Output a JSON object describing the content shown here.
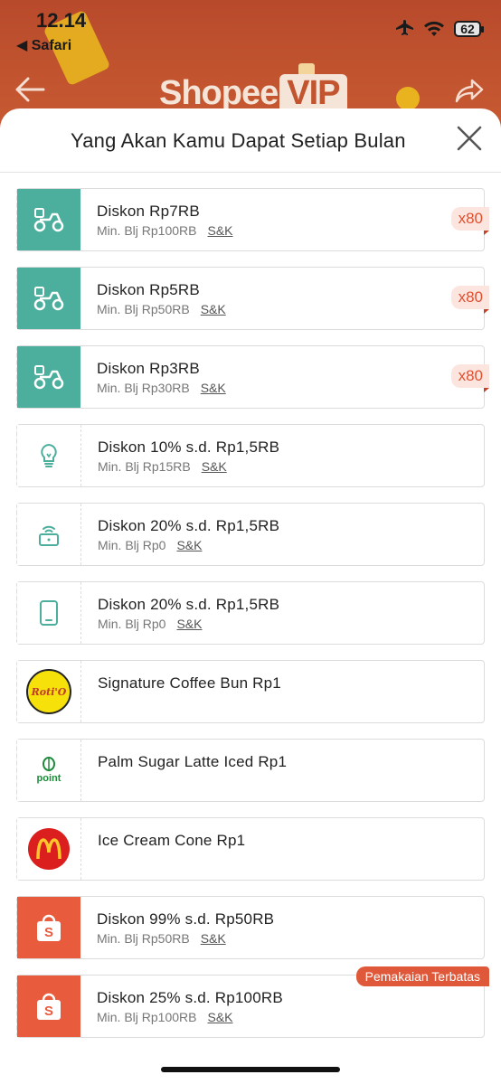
{
  "status": {
    "time": "12.14",
    "back_app": "◀ Safari",
    "battery": "62"
  },
  "brand": {
    "text": "Shopee",
    "vip": "VIP"
  },
  "sheet": {
    "title": "Yang Akan Kamu Dapat Setiap Bulan"
  },
  "colors": {
    "teal": "#4cae9d",
    "orange": "#e85b3d",
    "accent": "#e0502f"
  },
  "vouchers": [
    {
      "icon": "delivery-bike-icon",
      "title": "Diskon Rp7RB",
      "min": "Min. Blj Rp100RB",
      "terms": "S&K",
      "qty": "x80"
    },
    {
      "icon": "delivery-bike-icon",
      "title": "Diskon Rp5RB",
      "min": "Min. Blj Rp50RB",
      "terms": "S&K",
      "qty": "x80"
    },
    {
      "icon": "delivery-bike-icon",
      "title": "Diskon Rp3RB",
      "min": "Min. Blj Rp30RB",
      "terms": "S&K",
      "qty": "x80"
    },
    {
      "icon": "lightbulb-icon",
      "title": "Diskon 10% s.d. Rp1,5RB",
      "min": "Min. Blj Rp15RB",
      "terms": "S&K"
    },
    {
      "icon": "wifi-router-icon",
      "title": "Diskon 20% s.d. Rp1,5RB",
      "min": "Min. Blj Rp0",
      "terms": "S&K"
    },
    {
      "icon": "phone-icon",
      "title": "Diskon 20% s.d. Rp1,5RB",
      "min": "Min. Blj Rp0",
      "terms": "S&K"
    },
    {
      "icon": "rotio-logo",
      "title": "Signature Coffee Bun Rp1",
      "logo_text": "Roti'O"
    },
    {
      "icon": "point-coffee-logo",
      "title": "Palm Sugar Latte Iced Rp1",
      "logo_text": "point"
    },
    {
      "icon": "mcdonalds-logo",
      "title": "Ice Cream Cone Rp1"
    },
    {
      "icon": "shopee-bag-icon",
      "title": "Diskon 99% s.d. Rp50RB",
      "min": "Min. Blj Rp50RB",
      "terms": "S&K"
    },
    {
      "icon": "shopee-bag-icon",
      "title": "Diskon 25% s.d. Rp100RB",
      "min": "Min. Blj Rp100RB",
      "terms": "S&K",
      "badge": "Pemakaian Terbatas"
    }
  ]
}
